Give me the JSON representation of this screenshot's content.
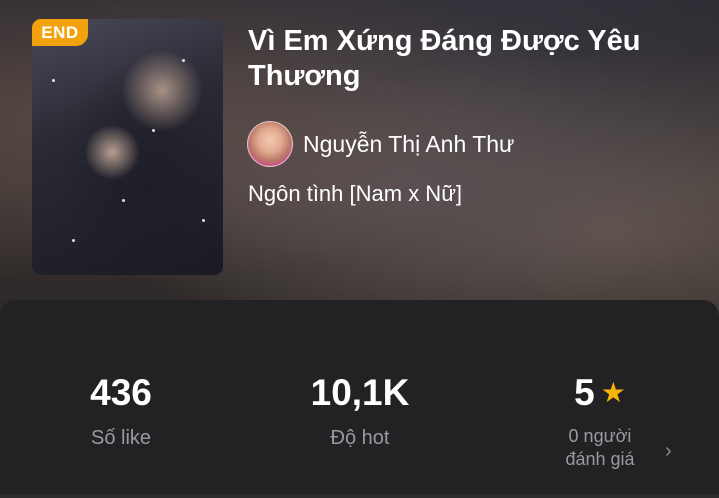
{
  "story": {
    "status_badge": "END",
    "title": "Vì Em Xứng Đáng Được Yêu Thương",
    "author_name": "Nguyễn Thị Anh Thư",
    "genre": "Ngôn tình [Nam x Nữ]"
  },
  "stats": {
    "likes_value": "436",
    "likes_label": "Số like",
    "hot_value": "10,1K",
    "hot_label": "Độ hot",
    "rating_value": "5",
    "rating_label_line1": "0 người",
    "rating_label_line2": "đánh giá"
  },
  "icons": {
    "star": "star-icon",
    "chevron": "chevron-right-icon"
  },
  "colors": {
    "badge": "#f2a20d",
    "star": "#f5b40c",
    "panel": "#222224"
  }
}
